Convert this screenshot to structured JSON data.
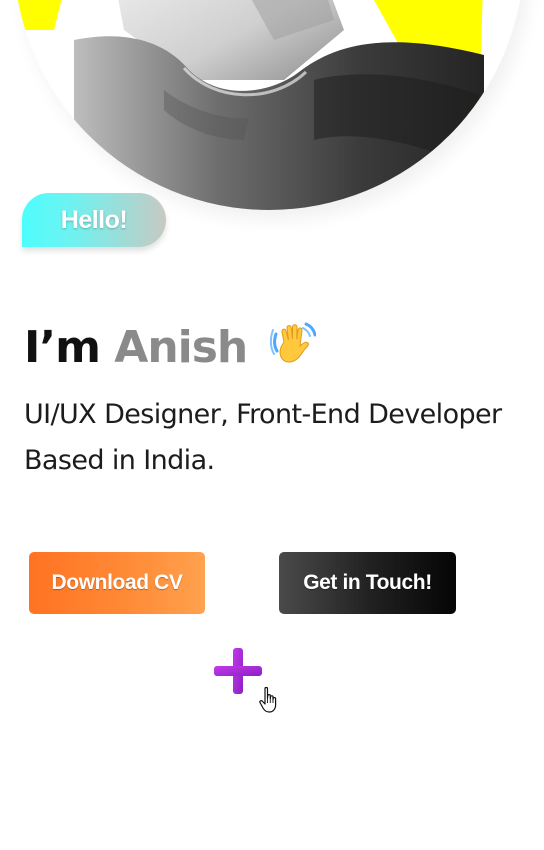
{
  "profile": {
    "photo_alt": "",
    "hello_badge": "Hello!",
    "greeting_prefix": "I’m",
    "name": "Anish",
    "wave_icon": "waving-hand-icon",
    "tagline_line1": "UI/UX Designer, Front-End Developer",
    "tagline_line2": "Based in India."
  },
  "actions": {
    "download_cv": "Download CV",
    "get_in_touch": "Get in Touch!"
  },
  "decor": {
    "plus_icon": "plus-icon",
    "cursor_icon": "hand-pointer-cursor-icon"
  },
  "colors": {
    "photo_background": "#ffff00",
    "hello_gradient_start": "#4dfdfd",
    "hello_gradient_end": "#c7c9c2",
    "name_gray": "#8a8a8a",
    "download_orange": "#ff7a26",
    "touch_black": "#1f1f1f",
    "plus_purple": "#a528d8"
  }
}
